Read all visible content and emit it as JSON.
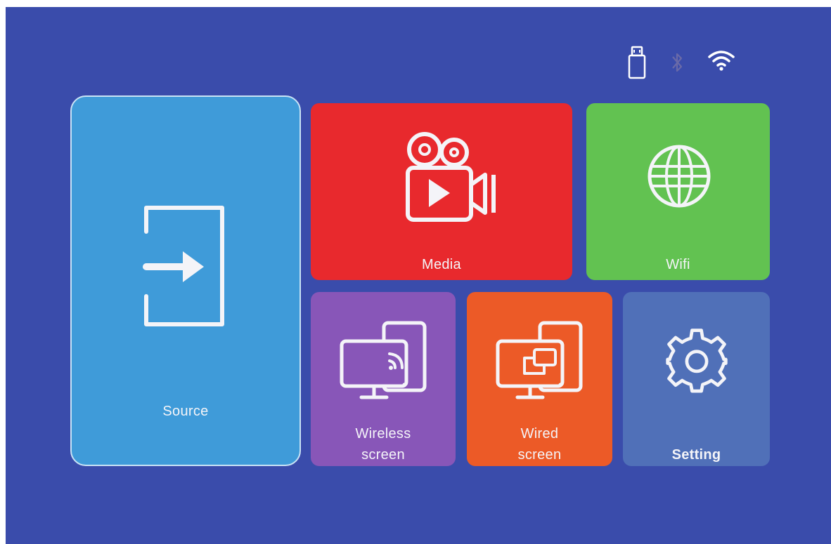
{
  "status_bar": {
    "icons": [
      "usb-drive-icon",
      "bluetooth-icon",
      "wifi-signal-icon"
    ],
    "colors": {
      "usb": "#ffffff",
      "bluetooth": "#6a6aa8",
      "wifi": "#ffffff"
    }
  },
  "tiles": {
    "source": {
      "label": "Source",
      "icon": "input-source-icon",
      "color": "#3f9bd9"
    },
    "media": {
      "label": "Media",
      "icon": "video-camera-icon",
      "color": "#e8292d"
    },
    "wifi": {
      "label": "Wifi",
      "icon": "globe-icon",
      "color": "#62c251"
    },
    "wireless": {
      "label_line1": "Wireless",
      "label_line2": "screen",
      "icon": "screen-cast-icon",
      "color": "#8856b8"
    },
    "wired": {
      "label_line1": "Wired",
      "label_line2": "screen",
      "icon": "screen-mirror-icon",
      "color": "#ec5a27"
    },
    "setting": {
      "label": "Setting",
      "icon": "gear-icon",
      "color": "#5070b8"
    }
  }
}
